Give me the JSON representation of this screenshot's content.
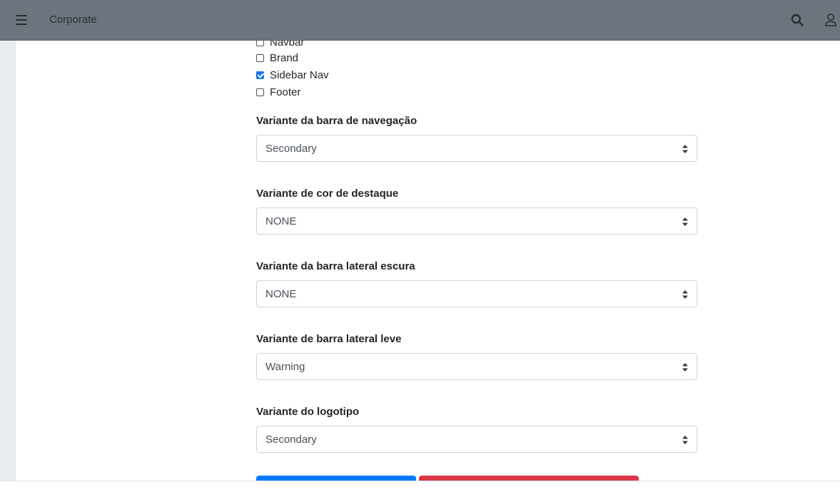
{
  "header": {
    "brand": "Corporate"
  },
  "checkboxes": [
    {
      "label": "Navbar",
      "checked": false
    },
    {
      "label": "Brand",
      "checked": false
    },
    {
      "label": "Sidebar Nav",
      "checked": true
    },
    {
      "label": "Footer",
      "checked": false
    }
  ],
  "form": {
    "navbar_variant": {
      "label": "Variante da barra de navegação",
      "value": "Secondary"
    },
    "accent_variant": {
      "label": "Variante de cor de destaque",
      "value": "NONE"
    },
    "dark_sidebar_variant": {
      "label": "Variante da barra lateral escura",
      "value": "NONE"
    },
    "light_sidebar_variant": {
      "label": "Variante de barra lateral leve",
      "value": "Warning"
    },
    "logo_variant": {
      "label": "Variante do logotipo",
      "value": "Secondary"
    }
  },
  "colors": {
    "header_bg": "#6c757d",
    "primary": "#007bff",
    "danger": "#dc3545",
    "checkbox_checked": "#1a73e8"
  },
  "icons": [
    "hamburger-icon",
    "search-icon",
    "user-icon",
    "select-arrows-icon"
  ]
}
